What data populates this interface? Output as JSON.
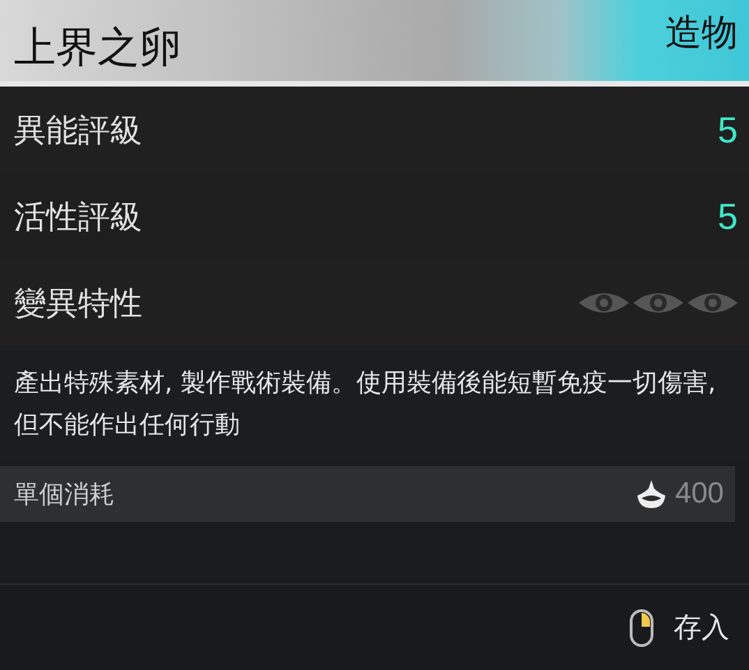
{
  "header": {
    "title": "上界之卵",
    "category": "造物"
  },
  "stats": [
    {
      "kind": "rating",
      "label": "異能評級",
      "value": "5"
    },
    {
      "kind": "rating",
      "label": "活性評級",
      "value": "5"
    },
    {
      "kind": "traits",
      "label": "變異特性"
    }
  ],
  "description": "產出特殊素材, 製作戰術裝備。使用裝備後能短暫免疫一切傷害, 但不能作出任何行動",
  "cost": {
    "label": "單個消耗",
    "amount": "400"
  },
  "footer": {
    "action": "存入"
  }
}
